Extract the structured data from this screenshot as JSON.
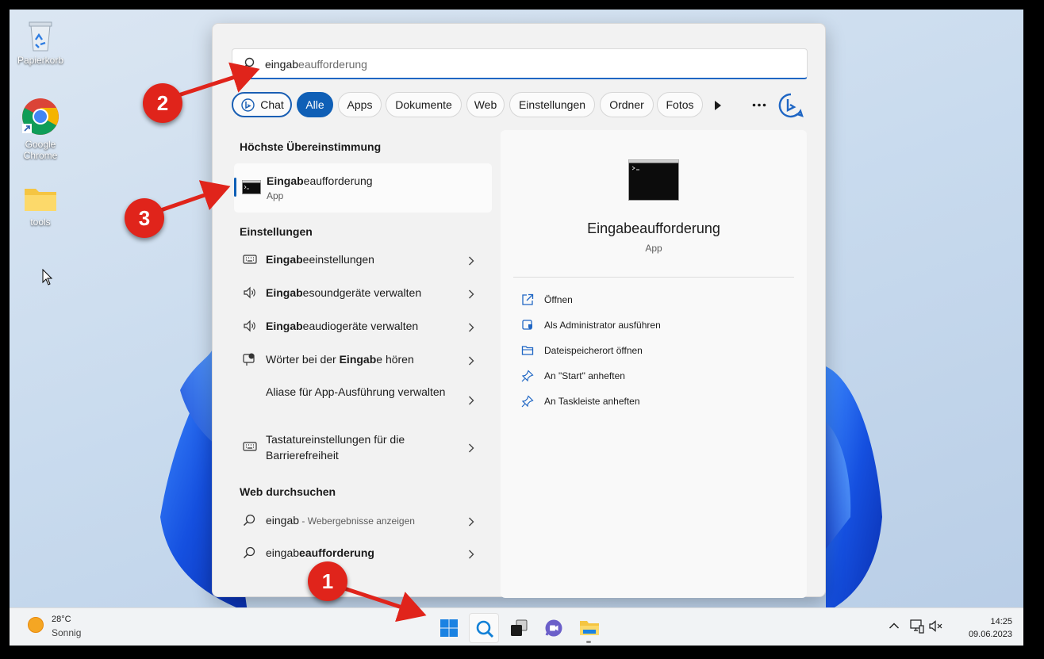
{
  "desktop": {
    "icons": [
      {
        "label": "Papierkorb",
        "icon": "recycle-bin-icon"
      },
      {
        "label": "Google Chrome",
        "icon": "chrome-icon"
      },
      {
        "label": "tools",
        "icon": "folder-icon"
      }
    ]
  },
  "search": {
    "query_typed": "eingab",
    "query_rest": "eaufforderung"
  },
  "filters": [
    "Chat",
    "Alle",
    "Apps",
    "Dokumente",
    "Web",
    "Einstellungen",
    "Ordner",
    "Fotos"
  ],
  "best_match": {
    "heading": "Höchste Übereinstimmung",
    "name_bold": "Eingab",
    "name_rest": "eaufforderung",
    "type": "App"
  },
  "settings": {
    "heading": "Einstellungen",
    "items": [
      {
        "pre": "",
        "bold": "Eingab",
        "post": "eeinstellungen",
        "icon": "keyboard-icon"
      },
      {
        "pre": "",
        "bold": "Eingab",
        "post": "esoundgeräte verwalten",
        "icon": "speaker-icon"
      },
      {
        "pre": "",
        "bold": "Eingab",
        "post": "eaudiogeräte verwalten",
        "icon": "speaker-icon"
      },
      {
        "pre": "Wörter bei der ",
        "bold": "Eingab",
        "post": "e hören",
        "icon": "speech-icon"
      },
      {
        "pre": "Aliase für App-Ausführung verwalten",
        "bold": "",
        "post": "",
        "icon": ""
      },
      {
        "pre": "Tastatureinstellungen für die Barrierefreiheit",
        "bold": "",
        "post": "",
        "icon": "keyboard-icon"
      }
    ]
  },
  "web": {
    "heading": "Web durchsuchen",
    "items": [
      {
        "pre": "eingab",
        "bold": "",
        "post": "",
        "sub": " - Webergebnisse anzeigen"
      },
      {
        "pre": "eingab",
        "bold": "eaufforderung",
        "post": "",
        "sub": ""
      }
    ]
  },
  "preview": {
    "name": "Eingabeaufforderung",
    "type": "App",
    "actions": [
      {
        "label": "Öffnen",
        "icon": "open-external-icon"
      },
      {
        "label": "Als Administrator ausführen",
        "icon": "shield-admin-icon"
      },
      {
        "label": "Dateispeicherort öffnen",
        "icon": "folder-open-icon"
      },
      {
        "label": "An \"Start\" anheften",
        "icon": "pin-icon"
      },
      {
        "label": "An Taskleiste anheften",
        "icon": "pin-icon"
      }
    ]
  },
  "taskbar": {
    "weather_temp": "28°C",
    "weather_desc": "Sonnig",
    "time": "14:25",
    "date": "09.06.2023"
  },
  "callouts": [
    "1",
    "2",
    "3"
  ],
  "colors": {
    "accent": "#0f5fb6",
    "callout": "#e0241b"
  }
}
